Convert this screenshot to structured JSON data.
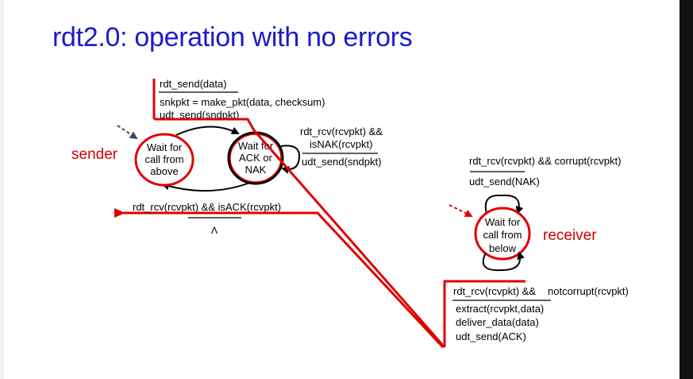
{
  "slide": {
    "title": "rdt2.0: operation with no errors"
  },
  "sender": {
    "role_label": "sender",
    "state_wait_call": [
      "Wait for",
      "call from",
      "above"
    ],
    "state_wait_ack": [
      "Wait for",
      "ACK or",
      "NAK"
    ],
    "init_transition": {
      "event": "rdt_send(data)",
      "actions": [
        "snkpkt = make_pkt(data, checksum)",
        "udt_send(sndpkt)"
      ]
    },
    "nak_transition": {
      "event_lines": [
        "rdt_rcv(rcvpkt) &&",
        "isNAK(rcvpkt)"
      ],
      "action": "udt_send(sndpkt)"
    },
    "ack_transition": {
      "event": "rdt_rcv(rcvpkt) && isACK(rcvpkt)",
      "action": "Λ"
    }
  },
  "receiver": {
    "role_label": "receiver",
    "state_wait_below": [
      "Wait for",
      "call from",
      "below"
    ],
    "corrupt_transition": {
      "event": "rdt_rcv(rcvpkt) && corrupt(rcvpkt)",
      "action": "udt_send(NAK)"
    },
    "notcorrupt_transition": {
      "event_part1": "rdt_rcv(rcvpkt) &&",
      "event_part2": "notcorrupt(rcvpkt)",
      "actions": [
        "extract(rcvpkt,data)",
        "deliver_data(data)",
        "udt_send(ACK)"
      ]
    }
  },
  "colors": {
    "title": "#1a1acc",
    "highlight": "#e00000",
    "role_text": "#d40000",
    "dashed_arrow_sender": "#444466",
    "dashed_arrow_receiver": "#e00000"
  }
}
